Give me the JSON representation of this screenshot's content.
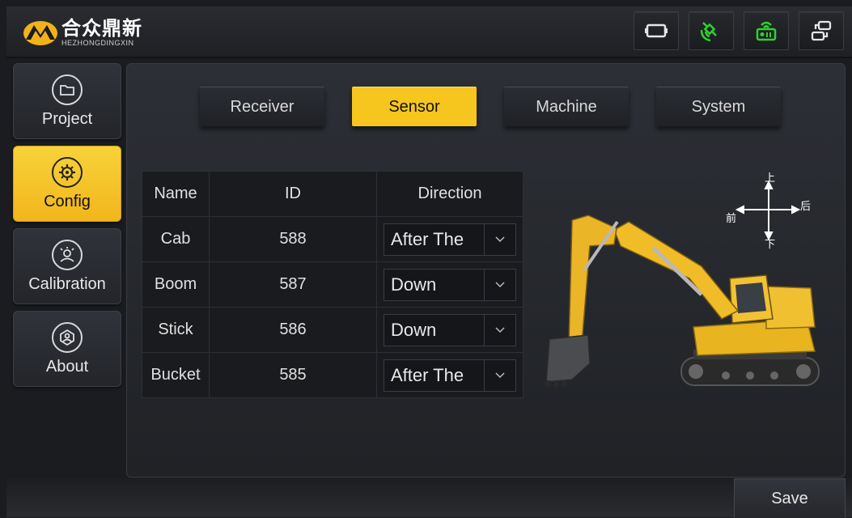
{
  "brand": {
    "name_cn": "合众鼎新",
    "name_en": "HEZHONGDINGXIN"
  },
  "topbar": {
    "icons": [
      "screen-icon",
      "satellite-icon",
      "radio-icon",
      "network-icon"
    ]
  },
  "sidebar": {
    "items": [
      {
        "label": "Project",
        "icon": "folder-icon",
        "active": false
      },
      {
        "label": "Config",
        "icon": "settings-icon",
        "active": true
      },
      {
        "label": "Calibration",
        "icon": "calibration-icon",
        "active": false
      },
      {
        "label": "About",
        "icon": "about-icon",
        "active": false
      }
    ]
  },
  "tabs": [
    {
      "label": "Receiver",
      "active": false
    },
    {
      "label": "Sensor",
      "active": true
    },
    {
      "label": "Machine",
      "active": false
    },
    {
      "label": "System",
      "active": false
    }
  ],
  "table": {
    "headers": [
      "Name",
      "ID",
      "Direction"
    ],
    "rows": [
      {
        "name": "Cab",
        "id": "588",
        "direction": "After The"
      },
      {
        "name": "Boom",
        "id": "587",
        "direction": "Down"
      },
      {
        "name": "Stick",
        "id": "586",
        "direction": "Down"
      },
      {
        "name": "Bucket",
        "id": "585",
        "direction": "After The"
      }
    ]
  },
  "compass": {
    "up": "上",
    "down": "下",
    "front": "前",
    "back": "后"
  },
  "footer": {
    "save_label": "Save"
  },
  "colors": {
    "accent": "#f6c51e",
    "background": "#1a1c20",
    "panel": "#2a2d33"
  }
}
